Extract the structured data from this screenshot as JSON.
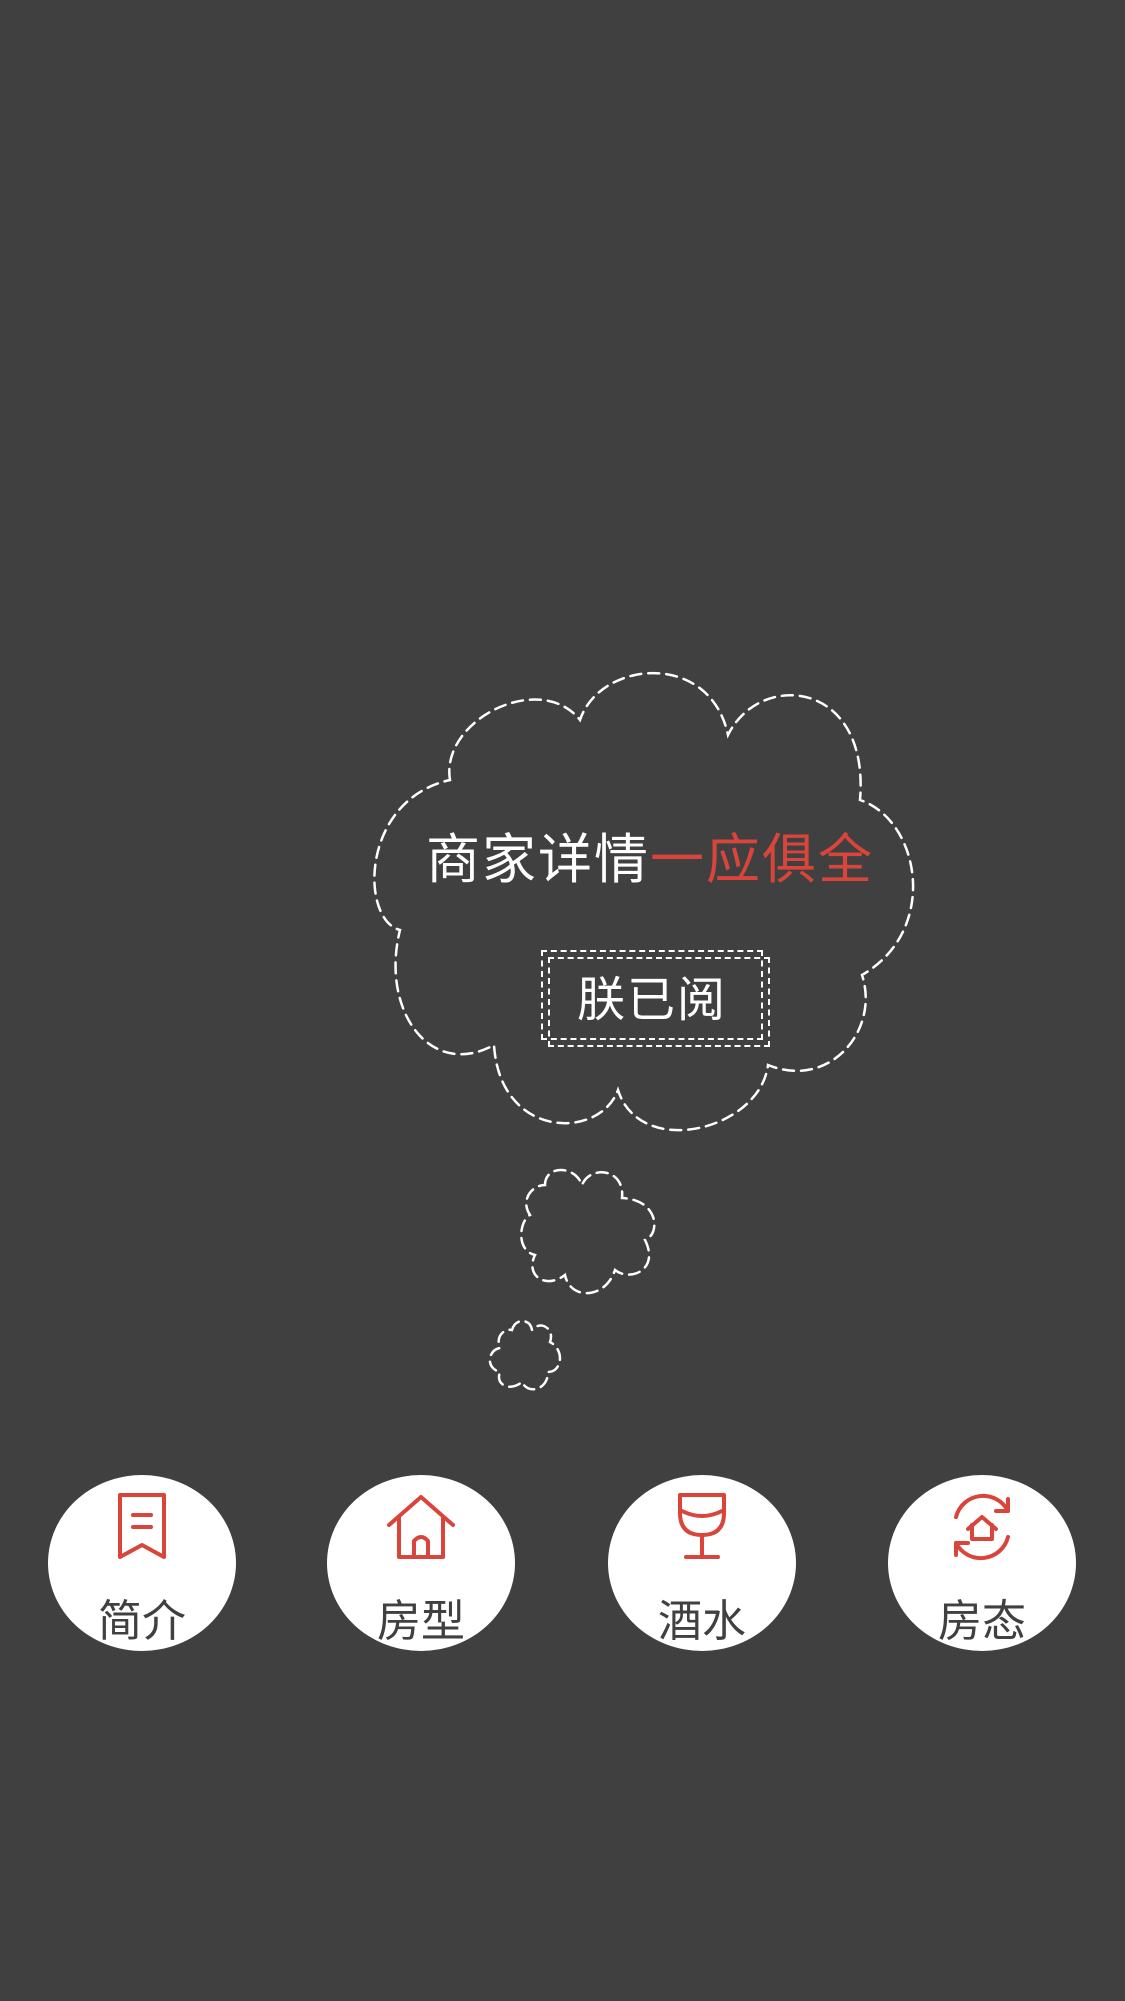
{
  "headline": {
    "white_text": "商家详情",
    "red_text": "一应俱全"
  },
  "read_button": {
    "label": "朕已阅"
  },
  "nav": {
    "items": [
      {
        "label": "简介",
        "icon": "bookmark-icon"
      },
      {
        "label": "房型",
        "icon": "house-icon"
      },
      {
        "label": "酒水",
        "icon": "wine-glass-icon"
      },
      {
        "label": "房态",
        "icon": "house-refresh-icon"
      }
    ]
  },
  "colors": {
    "background": "#404040",
    "accent": "#d9453b",
    "outline": "#ffffff"
  }
}
